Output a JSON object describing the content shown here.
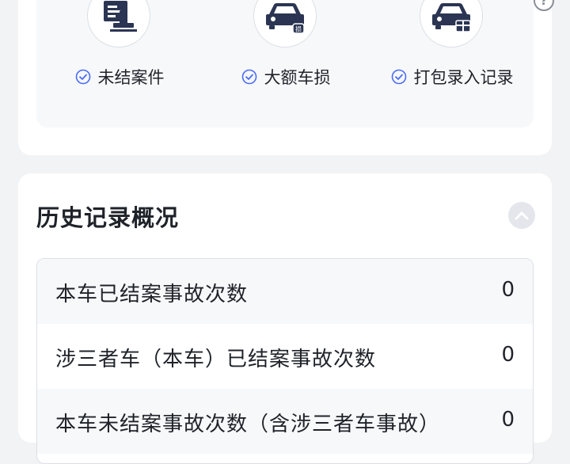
{
  "features": [
    {
      "label": "未结案件",
      "icon": "document-stamp-icon",
      "checked": true
    },
    {
      "label": "大额车损",
      "icon": "car-damage-icon",
      "checked": true
    },
    {
      "label": "打包录入记录",
      "icon": "car-package-icon",
      "checked": true
    }
  ],
  "help_symbol": "?",
  "history": {
    "title": "历史记录概况",
    "rows": [
      {
        "label": "本车已结案事故次数",
        "value": "0"
      },
      {
        "label": "涉三者车（本车）已结案事故次数",
        "value": "0"
      },
      {
        "label": "本车未结案事故次数（含涉三者车事故）",
        "value": "0"
      }
    ]
  },
  "colors": {
    "accent": "#4a6cf7",
    "icon_navy": "#2b3553",
    "page_bg": "#f2f3f5"
  }
}
